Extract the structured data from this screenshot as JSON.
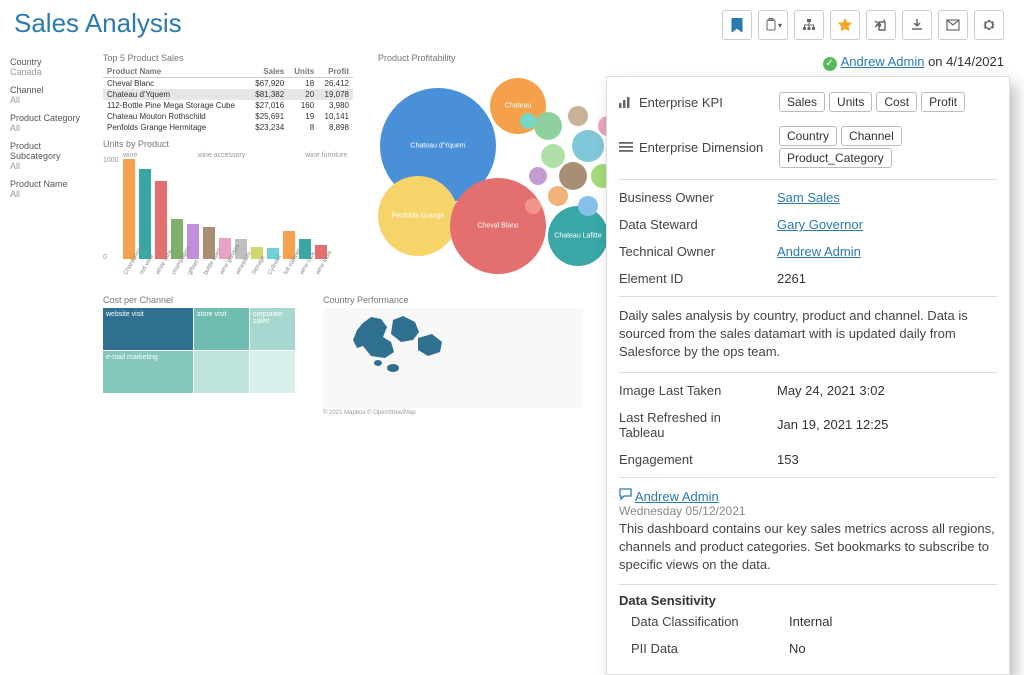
{
  "page_title": "Sales Analysis",
  "filters": [
    {
      "label": "Country",
      "value": "Canada"
    },
    {
      "label": "Channel",
      "value": "All"
    },
    {
      "label": "Product Category",
      "value": "All"
    },
    {
      "label": "Product Subcategory",
      "value": "All"
    },
    {
      "label": "Product Name",
      "value": "All"
    }
  ],
  "product_table": {
    "title": "Top 5 Product Sales",
    "headers": [
      "Product Name",
      "Sales",
      "Units",
      "Profit"
    ],
    "rows": [
      [
        "Cheval Blanc",
        "$67,920",
        "18",
        "26,412"
      ],
      [
        "Chateau d'Yquem",
        "$81,382",
        "20",
        "19,078"
      ],
      [
        "112-Bottle Pine Mega Storage Cube",
        "$27,016",
        "160",
        "3,980"
      ],
      [
        "Chateau Mouton Rothschild",
        "$25,691",
        "19",
        "10,141"
      ],
      [
        "Penfolds Grange Hermitage",
        "$23,234",
        "8",
        "8,898"
      ]
    ],
    "highlight_row": 1
  },
  "bar_chart": {
    "title": "Units by Product",
    "series_labels": [
      "wine",
      "wine accessory",
      "wine furniture"
    ],
    "yticks": [
      "1000",
      "0"
    ],
    "categories": [
      "Chardonnay",
      "red wine",
      "white wine",
      "champagne",
      "giftset",
      "bottle open",
      "wine glasses",
      "wineplum",
      "Storage",
      "Cylinder",
      "full cabinet",
      "wine rack",
      "wine tools"
    ],
    "values": [
      1000,
      900,
      780,
      400,
      350,
      320,
      210,
      200,
      120,
      110,
      280,
      200,
      140
    ],
    "colors": [
      "#f5a04a",
      "#3aa6a6",
      "#e36f6f",
      "#7fb069",
      "#c08fd8",
      "#a88f74",
      "#e9a3c2",
      "#bfbfbf",
      "#cfd96a",
      "#6fd0d6",
      "#f5a04a",
      "#3aa6a6",
      "#e36f6f"
    ]
  },
  "treemap": {
    "title": "Cost per Channel",
    "cells": [
      {
        "label": "website visit",
        "color": "#2f6f8f"
      },
      {
        "label": "store visit",
        "color": "#6fbdb0"
      },
      {
        "label": "corporate sales",
        "color": "#a7d8d0"
      },
      {
        "label": "e-mail marketing",
        "color": "#86c7bc"
      },
      {
        "label": "",
        "color": "#bfe3dd"
      },
      {
        "label": "",
        "color": "#d8efeb"
      }
    ]
  },
  "map": {
    "title": "Country Performance",
    "attribution": "© 2021 Mapbox © OpenStreetMap"
  },
  "bubbles": {
    "title": "Product Profitability",
    "labels": [
      "Chateau d'Yquem",
      "Chateau",
      "Penfolds Grange",
      "Cheval Blanc",
      "Chateau Lafitte"
    ]
  },
  "certification": {
    "by": "Andrew Admin",
    "on": "4/14/2021"
  },
  "panel": {
    "kpi_label": "Enterprise KPI",
    "kpi_tags": [
      "Sales",
      "Units",
      "Cost",
      "Profit"
    ],
    "dim_label": "Enterprise Dimension",
    "dim_tags": [
      "Country",
      "Channel",
      "Product_Category"
    ],
    "rows": [
      {
        "label": "Business Owner",
        "value": "Sam Sales",
        "link": true
      },
      {
        "label": "Data Steward",
        "value": "Gary Governor",
        "link": true
      },
      {
        "label": "Technical Owner",
        "value": "Andrew Admin",
        "link": true
      },
      {
        "label": "Element ID",
        "value": "2261"
      }
    ],
    "description": "Daily sales analysis by country, product and channel. Data is sourced from the sales datamart with is updated daily from Salesforce by the ops team.",
    "meta": [
      {
        "label": "Image Last Taken",
        "value": "May 24, 2021 3:02"
      },
      {
        "label": "Last Refreshed in Tableau",
        "value": "Jan 19, 2021 12:25"
      },
      {
        "label": "Engagement",
        "value": "153"
      }
    ],
    "comment": {
      "who": "Andrew Admin",
      "date": "Wednesday 05/12/2021",
      "text": "This dashboard contains our key sales metrics across all regions, channels and product categories. Set bookmarks to subscribe to specific views on the data."
    },
    "sensitivity": {
      "heading": "Data Sensitivity",
      "rows": [
        {
          "label": "Data Classification",
          "value": "Internal"
        },
        {
          "label": "PII Data",
          "value": "No"
        }
      ]
    }
  }
}
